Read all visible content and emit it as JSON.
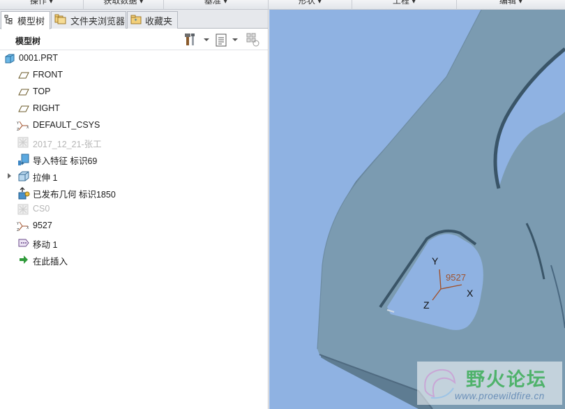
{
  "ribbon": {
    "groups": [
      "操作",
      "获取数据",
      "基准",
      "形状",
      "工程",
      "编辑"
    ]
  },
  "tabs": [
    {
      "label": "模型树",
      "icon": "model-tree-icon",
      "active": true
    },
    {
      "label": "文件夹浏览器",
      "icon": "folder-browser-icon",
      "active": false
    },
    {
      "label": "收藏夹",
      "icon": "favorites-icon",
      "active": false
    }
  ],
  "tree": {
    "title": "模型树",
    "items": [
      {
        "label": "0001.PRT",
        "icon": "part-icon",
        "dimmed": false
      },
      {
        "label": "FRONT",
        "icon": "datum-plane-icon",
        "dimmed": false
      },
      {
        "label": "TOP",
        "icon": "datum-plane-icon",
        "dimmed": false
      },
      {
        "label": "RIGHT",
        "icon": "datum-plane-icon",
        "dimmed": false
      },
      {
        "label": "DEFAULT_CSYS",
        "icon": "csys-icon",
        "dimmed": false
      },
      {
        "label": "2017_12_21-张工",
        "icon": "suppressed-feature-icon",
        "dimmed": true
      },
      {
        "label": "导入特征 标识69",
        "icon": "import-feature-icon",
        "dimmed": false
      },
      {
        "label": "拉伸 1",
        "icon": "extrude-icon",
        "dimmed": false,
        "expandable": true
      },
      {
        "label": "已发布几何 标识1850",
        "icon": "published-geometry-icon",
        "dimmed": false
      },
      {
        "label": "CS0",
        "icon": "suppressed-feature-icon",
        "dimmed": true
      },
      {
        "label": "9527",
        "icon": "csys-icon",
        "dimmed": false
      },
      {
        "label": "移动 1",
        "icon": "move-icon",
        "dimmed": false
      },
      {
        "label": "在此插入",
        "icon": "insert-here-arrow-icon",
        "dimmed": false
      }
    ]
  },
  "viewport": {
    "background": "#8fb2e2",
    "part_color": "#7b9bb1",
    "csys": {
      "name": "9527",
      "x_label": "X",
      "y_label": "Y",
      "z_label": "Z"
    }
  },
  "watermark": {
    "title": "野火论坛",
    "url": "www.proewildfire.cn"
  }
}
